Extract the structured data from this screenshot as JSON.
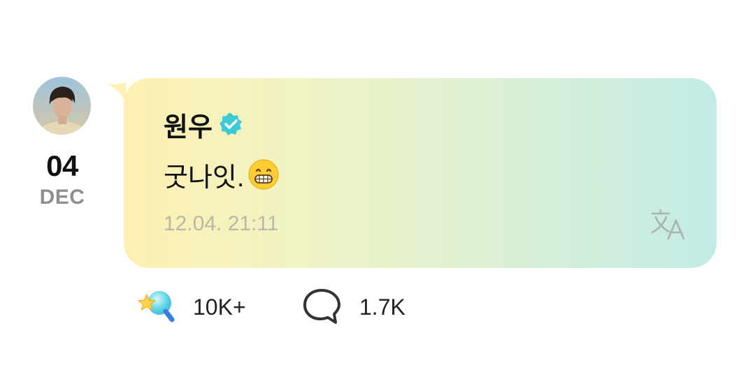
{
  "post": {
    "author": {
      "name": "원우",
      "verified": true,
      "verified_icon": "verified-badge-icon",
      "verified_color": "#3ec9d6"
    },
    "date": {
      "day": "04",
      "month": "DEC"
    },
    "message": {
      "text": "굿나잇.",
      "emoji": "grinning-face-emoji"
    },
    "timestamp": "12.04. 21:11",
    "translate_icon": "translate-icon"
  },
  "stats": {
    "likes": {
      "icon": "star-wand-icon",
      "count": "10K+"
    },
    "comments": {
      "icon": "speech-bubble-icon",
      "count": "1.7K"
    }
  },
  "colors": {
    "bubble_gradient_start": "#fdf0b2",
    "bubble_gradient_end": "#c2ebe6",
    "accent": "#3ec9d6"
  }
}
